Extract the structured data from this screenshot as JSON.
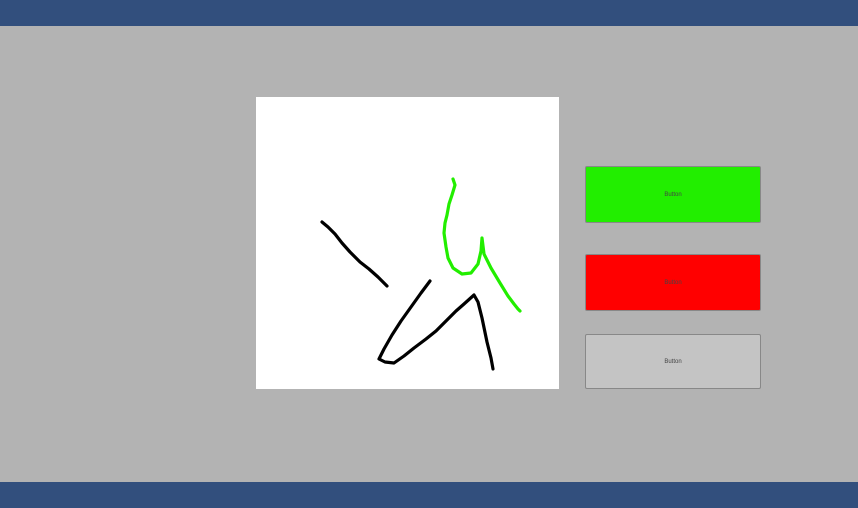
{
  "colors": {
    "top_bar": "#324f7d",
    "bottom_bar": "#324f7d",
    "background": "#b3b3b3",
    "canvas": "#ffffff",
    "stroke_black": "#000000",
    "stroke_green": "#22ee00"
  },
  "canvas": {
    "strokes": [
      {
        "name": "black-stroke-1",
        "color": "#000000"
      },
      {
        "name": "black-stroke-2",
        "color": "#000000"
      },
      {
        "name": "green-stroke-1",
        "color": "#22ee00"
      }
    ]
  },
  "buttons": [
    {
      "label": "Button",
      "color": "#22ee00"
    },
    {
      "label": "Button",
      "color": "#ff0000"
    },
    {
      "label": "Button",
      "color": "#c4c4c4"
    }
  ]
}
